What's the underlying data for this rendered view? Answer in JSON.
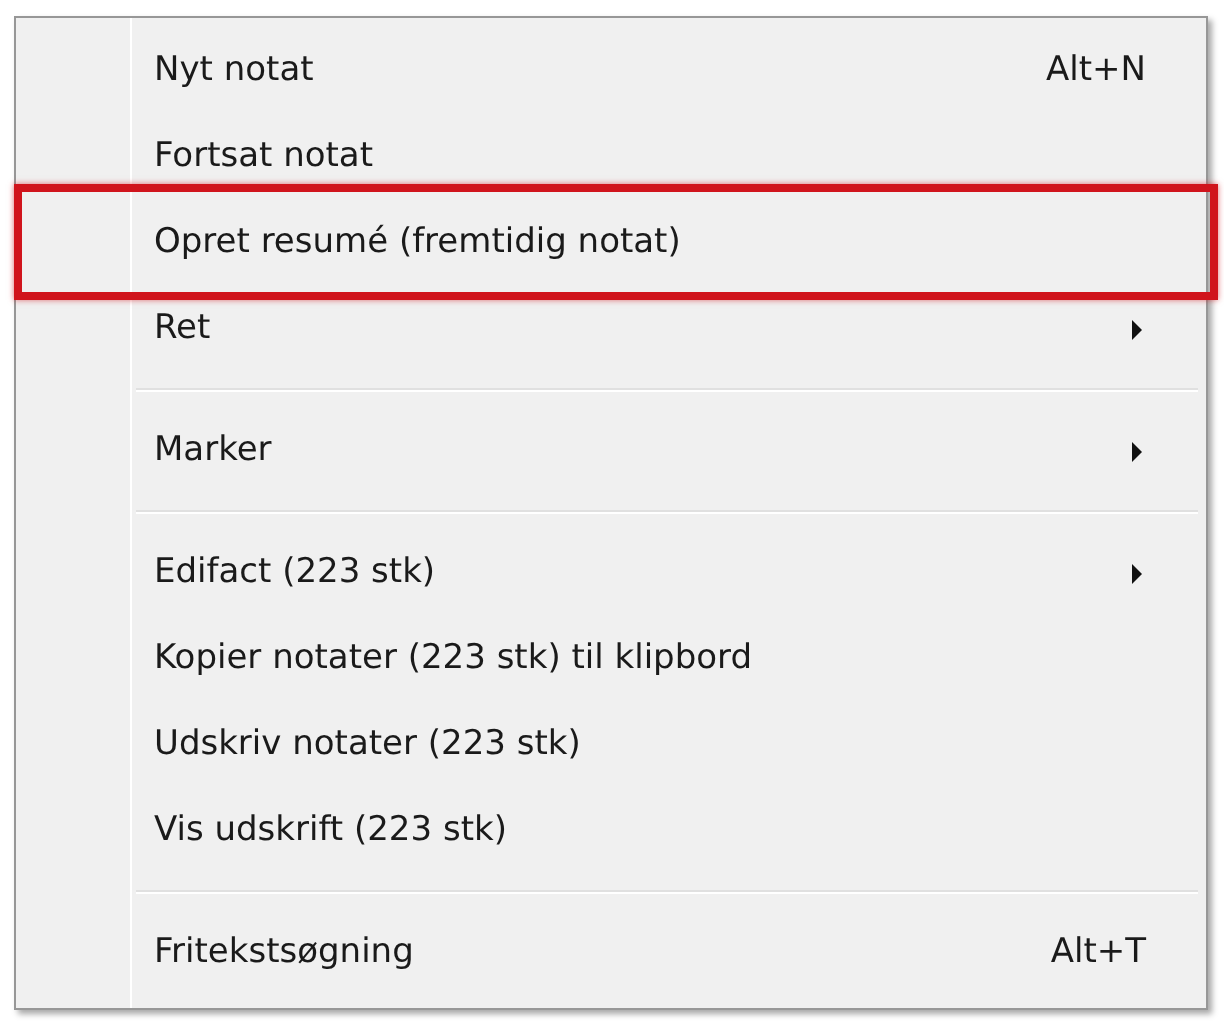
{
  "menu": {
    "items": [
      {
        "kind": "item",
        "label": "Nyt notat",
        "shortcut": "Alt+N",
        "submenu": false,
        "highlighted": false
      },
      {
        "kind": "item",
        "label": "Fortsat notat",
        "submenu": false,
        "highlighted": false
      },
      {
        "kind": "item",
        "label": "Opret resumé (fremtidig notat)",
        "submenu": false,
        "highlighted": true
      },
      {
        "kind": "item",
        "label": "Ret",
        "submenu": true,
        "highlighted": false
      },
      {
        "kind": "separator"
      },
      {
        "kind": "item",
        "label": "Marker",
        "submenu": true,
        "highlighted": false
      },
      {
        "kind": "separator"
      },
      {
        "kind": "item",
        "label": "Edifact (223 stk)",
        "submenu": true,
        "highlighted": false
      },
      {
        "kind": "item",
        "label": "Kopier notater (223 stk) til klipbord",
        "submenu": false,
        "highlighted": false
      },
      {
        "kind": "item",
        "label": "Udskriv notater (223 stk)",
        "submenu": false,
        "highlighted": false
      },
      {
        "kind": "item",
        "label": "Vis udskrift (223 stk)",
        "submenu": false,
        "highlighted": false
      },
      {
        "kind": "separator"
      },
      {
        "kind": "item",
        "label": "Fritekstsøgning",
        "shortcut": "Alt+T",
        "submenu": false,
        "highlighted": false
      }
    ]
  }
}
